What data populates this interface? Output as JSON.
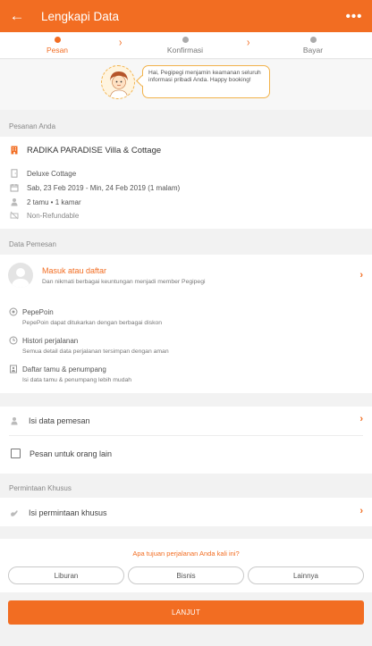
{
  "appbar": {
    "title": "Lengkapi Data",
    "back_icon": "←",
    "more_icon": "•••"
  },
  "steps": [
    {
      "label": "Pesan",
      "active": true
    },
    {
      "label": "Konfirmasi",
      "active": false
    },
    {
      "label": "Bayar",
      "active": false
    }
  ],
  "intro": {
    "bubble_text": "Hai, Pegipegi menjamin keamanan seluruh informasi pribadi Anda. Happy booking!"
  },
  "order": {
    "section_title": "Pesanan Anda",
    "hotel_name": "RADIKA PARADISE Villa & Cottage",
    "room_type": "Deluxe Cottage",
    "dates": "Sab, 23 Feb 2019 - Min, 24 Feb 2019 (1 malam)",
    "guests": "2 tamu • 1 kamar",
    "policy": "Non-Refundable"
  },
  "booking_data": {
    "section_title": "Data Pemesan",
    "login_title": "Masuk atau daftar",
    "login_subtitle": "Dan nikmati berbagai keuntungan menjadi member Pegipegi",
    "benefits": [
      {
        "title": "PepePoin",
        "desc": "PepePoin dapat ditukarkan dengan berbagai diskon"
      },
      {
        "title": "Histori perjalanan",
        "desc": "Semua detail data perjalanan tersimpan dengan aman"
      },
      {
        "title": "Daftar tamu & penumpang",
        "desc": "Isi data tamu & penumpang lebih mudah"
      }
    ]
  },
  "form": {
    "fill_booker": "Isi data pemesan",
    "book_for_others": "Pesan untuk orang lain"
  },
  "special": {
    "section_title": "Permintaan Khusus",
    "fill_request": "Isi permintaan khusus"
  },
  "purpose": {
    "question": "Apa tujuan perjalanan Anda kali ini?",
    "options": [
      "Liburan",
      "Bisnis",
      "Lainnya"
    ]
  },
  "cta": {
    "label": "LANJUT"
  },
  "colors": {
    "accent": "#f26d22",
    "bubble_border": "#f2b24a"
  }
}
